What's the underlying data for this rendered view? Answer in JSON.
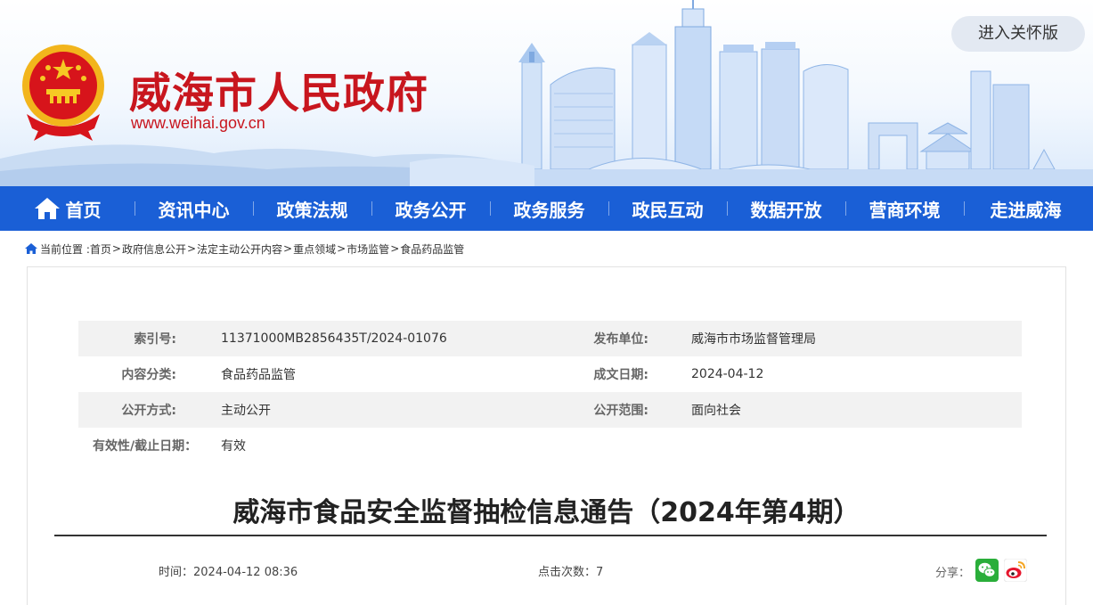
{
  "header": {
    "site_title": "威海市人民政府",
    "site_url": "www.weihai.gov.cn",
    "care_mode_button": "进入关怀版",
    "emblem_icon": "national-emblem-icon",
    "brand_color": "#c8161e"
  },
  "nav": {
    "color": "#1a5fd6",
    "items": [
      {
        "label": "首页",
        "icon": "home-icon"
      },
      {
        "label": "资讯中心"
      },
      {
        "label": "政策法规"
      },
      {
        "label": "政务公开"
      },
      {
        "label": "政务服务"
      },
      {
        "label": "政民互动"
      },
      {
        "label": "数据开放"
      },
      {
        "label": "营商环境"
      },
      {
        "label": "走进威海"
      }
    ]
  },
  "breadcrumb": {
    "prefix": "当前位置 :",
    "items": [
      "首页",
      "政府信息公开",
      "法定主动公开内容",
      "重点领域",
      "市场监管",
      "食品药品监管"
    ],
    "separator": ">"
  },
  "meta": {
    "index_label": "索引号:",
    "index_value": "11371000MB2856435T/2024-01076",
    "publisher_label": "发布单位:",
    "publisher_value": "威海市市场监督管理局",
    "category_label": "内容分类:",
    "category_value": "食品药品监管",
    "date_label": "成文日期:",
    "date_value": "2024-04-12",
    "method_label": "公开方式:",
    "method_value": "主动公开",
    "scope_label": "公开范围:",
    "scope_value": "面向社会",
    "validity_label": "有效性/截止日期：",
    "validity_value": "有效"
  },
  "article": {
    "title": "威海市食品安全监督抽检信息通告（2024年第4期）",
    "time_label": "时间：",
    "time_value": "2024-04-12 08:36",
    "clicks_label": "点击次数：",
    "clicks_value": "7",
    "share_label": "分享："
  }
}
